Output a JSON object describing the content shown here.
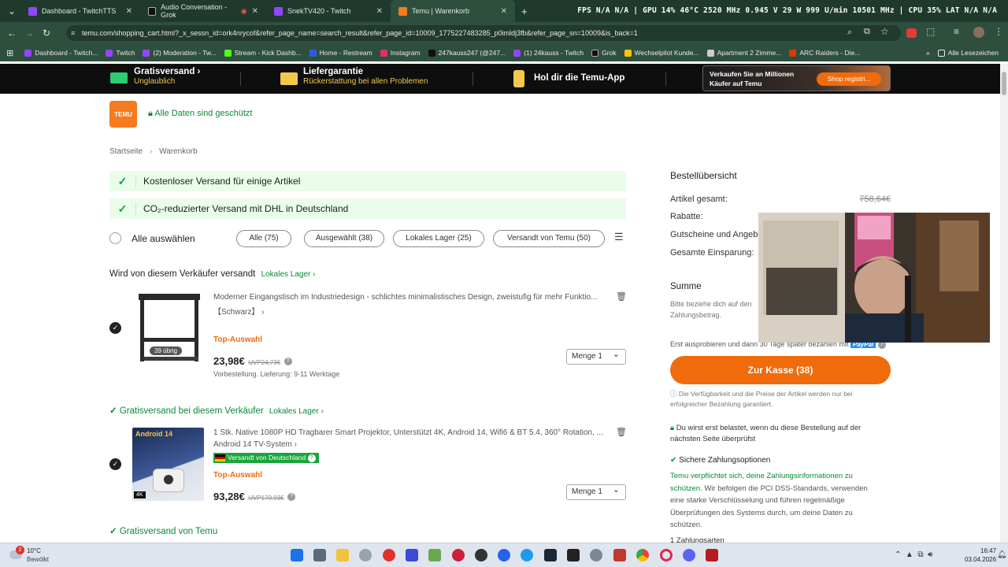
{
  "browser": {
    "tabs": [
      {
        "title": "Dashboard - TwitchTTS",
        "color": "#9146ff"
      },
      {
        "title": "Audio Conversation - Grok",
        "color": "#111111"
      },
      {
        "title": "SnekTV420 - Twitch",
        "color": "#9146ff"
      },
      {
        "title": "Temu | Warenkorb",
        "color": "#f47b20"
      }
    ],
    "new_tab": "+",
    "hud": "FPS  N/A   N/A  | GPU 14%  46°C 2520 MHz  0.945 V  29 W  999 U/min  10501 MHz | CPU 35%  LAT  N/A  N/A",
    "url": "temu.com/shopping_cart.html?_x_sessn_id=ork4nrycof&refer_page_name=search_result&refer_page_id=10009_1775227483285_p0imldj3fb&refer_page_sn=10009&is_back=1",
    "bookmarks": [
      {
        "label": "Dashboard - Twitch...",
        "color": "#9146ff"
      },
      {
        "label": "Twitch",
        "color": "#9146ff"
      },
      {
        "label": "(2) Moderation - Tw...",
        "color": "#9146ff"
      },
      {
        "label": "Stream - Kick Dashb...",
        "color": "#53fc18"
      },
      {
        "label": "Home - Restream",
        "color": "#2d5be3"
      },
      {
        "label": "Instagram",
        "color": "#e1306c"
      },
      {
        "label": "247kauss247 (@247...",
        "color": "#111111"
      },
      {
        "label": "(1) 24kauss - Twitch",
        "color": "#9146ff"
      },
      {
        "label": "Grok",
        "color": "#111111"
      },
      {
        "label": "Wechselpilot Kunde...",
        "color": "#f7c600"
      },
      {
        "label": "Apartment 2 Zimme...",
        "color": "#cccccc"
      },
      {
        "label": "ARC Raiders - Die...",
        "color": "#d83b01"
      }
    ],
    "all_bookmarks": "Alle Lesezeichen"
  },
  "banner": {
    "shipping_title": "Gratisversand",
    "shipping_sub": "Unglaublich",
    "guarantee_title": "Liefergarantie",
    "guarantee_sub": "Rückerstattung bei allen Problemen",
    "app": "Hol dir die Temu-App",
    "seller_text": "Verkaufen Sie an Millionen Käufer auf Temu",
    "seller_btn": "Shop registri..."
  },
  "header": {
    "logo_top": "TEMU",
    "secure": "Alle Daten sind geschützt"
  },
  "breadcrumb": [
    "Startseite",
    "Warenkorb"
  ],
  "notices": [
    "Kostenloser Versand für einige Artikel",
    "CO₂-reduzierter Versand mit DHL in Deutschland"
  ],
  "filters": {
    "select_all": "Alle auswählen",
    "chips": [
      "Alle (75)",
      "Ausgewählt (38)",
      "Lokales Lager (25)",
      "Versandt von Temu (50)"
    ]
  },
  "groups": [
    {
      "heading": "Wird von diesem Verkäufer versandt",
      "tag": "Lokales Lager"
    },
    {
      "heading": "Gratisversand bei diesem Verkäufer",
      "tag": "Lokales Lager"
    },
    {
      "heading": "Gratisversand von Temu",
      "tag": ""
    }
  ],
  "items": [
    {
      "title": "Moderner Eingangstisch im Industriedesign - schlichtes minimalistisches Design, zweistufig für mehr Funktio...",
      "variant": "【Schwarz】",
      "stock": "39 übrig",
      "badge": "Top-Auswahl",
      "price": "23,98€",
      "uvp": "UVP24,73€",
      "note": "Vorbestellung. Lieferung: 9-11 Werktage",
      "qty": "Menge 1"
    },
    {
      "title": "1 Stk. Native 1080P HD Tragbarer Smart Projektor, Unterstützt 4K, Android 14, Wifi6 & BT 5.4, 360° Rotation, ...",
      "variant": "Android 14 TV-System",
      "ship_tag": "Versandt von Deutschland",
      "img_label": "Android 14",
      "badge": "Top-Auswahl",
      "price": "93,28€",
      "uvp": "UVP170,93€",
      "qty": "Menge 1"
    }
  ],
  "summary": {
    "title": "Bestellübersicht",
    "rows": [
      {
        "label": "Artikel gesamt:",
        "value": "758,64€"
      },
      {
        "label": "Rabatte:",
        "value": ""
      },
      {
        "label": "Gutscheine und Angebo",
        "value": ""
      },
      {
        "label": "Gesamte Einsparung:",
        "value": ""
      }
    ],
    "sum_label": "Summe",
    "sum_note": "Bitte beziehe dich auf den",
    "sum_note2": "Zahlungsbetrag.",
    "paypal_note": "Erst ausprobieren und dann 30 Tage später bezahlen mit",
    "paypal": "PayPal",
    "checkout": "Zur Kasse (38)",
    "availability": "Die Verfügbarkeit und die Preise der Artikel werden nur bei erfolgreicher Bezahlung garantiert.",
    "charged": "Du wirst erst belastet, wenn du diese Bestellung auf der nächsten Seite überprüfst",
    "secure_title": "Sichere Zahlungsoptionen",
    "secure_link": "Temu verpflichtet sich, deine Zahlungsinformationen zu schützen.",
    "secure_text": "Wir befolgen die PCI DSS-Standards, verwenden eine starke Verschlüsselung und führen regelmäßige Überprüfungen des Systems durch, um deine Daten zu schützen.",
    "next": "1 Zahlungsarten"
  },
  "taskbar": {
    "weather_temp": "10°C",
    "weather_text": "Bewölkt",
    "notif": "2",
    "time": "16:47",
    "date": "03.04.2026"
  },
  "colors": {
    "accent": "#f06b0b",
    "green": "#0a8a36",
    "banner": "#0e0e0e"
  }
}
